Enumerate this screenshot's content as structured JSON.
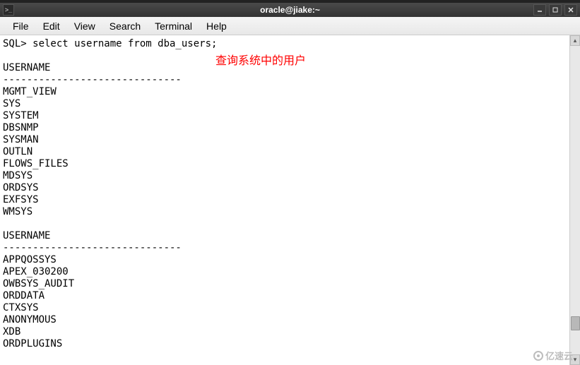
{
  "window": {
    "title": "oracle@jiake:~"
  },
  "menubar": {
    "items": [
      "File",
      "Edit",
      "View",
      "Search",
      "Terminal",
      "Help"
    ]
  },
  "terminal": {
    "prompt_line": "SQL> select username from dba_users;",
    "blank1": "",
    "header1": "USERNAME",
    "divider1": "------------------------------",
    "row1": "MGMT_VIEW",
    "row2": "SYS",
    "row3": "SYSTEM",
    "row4": "DBSNMP",
    "row5": "SYSMAN",
    "row6": "OUTLN",
    "row7": "FLOWS_FILES",
    "row8": "MDSYS",
    "row9": "ORDSYS",
    "row10": "EXFSYS",
    "row11": "WMSYS",
    "blank2": "",
    "header2": "USERNAME",
    "divider2": "------------------------------",
    "row12": "APPQOSSYS",
    "row13": "APEX_030200",
    "row14": "OWBSYS_AUDIT",
    "row15": "ORDDATA",
    "row16": "CTXSYS",
    "row17": "ANONYMOUS",
    "row18": "XDB",
    "row19": "ORDPLUGINS"
  },
  "annotation": {
    "text": "查询系统中的用户"
  },
  "watermark": {
    "text": "亿速云"
  }
}
